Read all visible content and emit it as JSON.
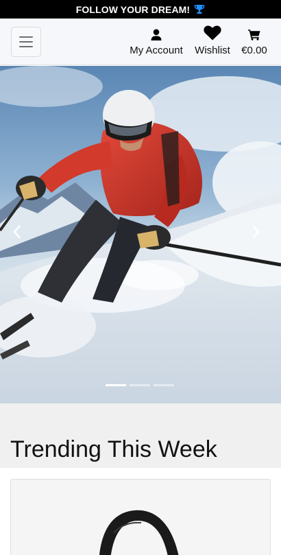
{
  "banner": {
    "text": "FOLLOW YOUR DREAM!",
    "icon": "trophy-icon",
    "icon_color": "#1e90ff"
  },
  "navbar": {
    "toggler_icon": "hamburger-menu-icon",
    "links": [
      {
        "label": "My Account",
        "icon": "user-icon"
      },
      {
        "label": "Wishlist",
        "icon": "heart-icon"
      },
      {
        "label": "€0.00",
        "icon": "shopping-cart-icon"
      }
    ]
  },
  "carousel": {
    "image": "skier-on-slope",
    "prev_icon": "chevron-left-icon",
    "next_icon": "chevron-right-icon",
    "slide_count": 3,
    "active_slide": 1
  },
  "trending": {
    "heading": "Trending This Week"
  },
  "product": {
    "image": "black-bag"
  }
}
